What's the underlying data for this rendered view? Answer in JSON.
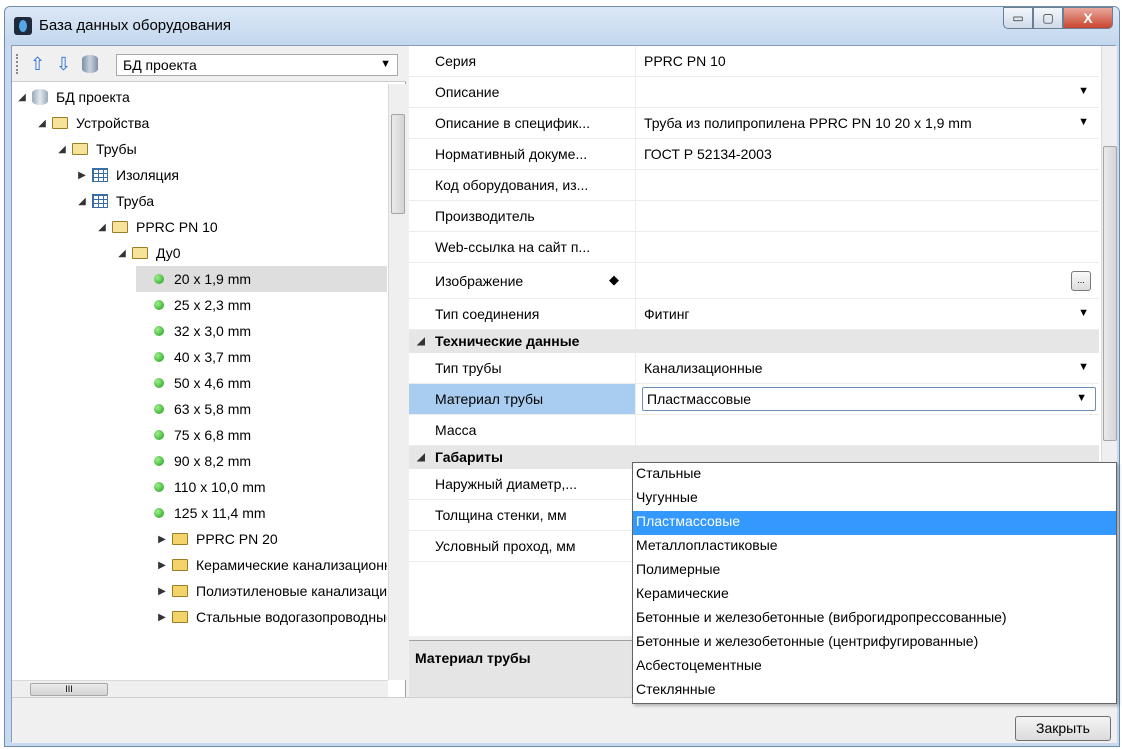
{
  "window": {
    "title": "База данных оборудования",
    "min_glyph": "▭",
    "max_glyph": "▢",
    "close_glyph": "X"
  },
  "toolbar": {
    "up_glyph": "⇧",
    "down_glyph": "⇩",
    "combo_value": "БД проекта",
    "combo_chevron": "▼"
  },
  "tree": {
    "root": "БД проекта",
    "devices": "Устройства",
    "pipes": "Трубы",
    "insulation": "Изоляция",
    "pipe": "Труба",
    "series_pn10": "PPRC PN 10",
    "du0": "Ду0",
    "sizes": [
      "20 x 1,9 mm",
      "25 x 2,3 mm",
      "32 x 3,0 mm",
      "40 x 3,7 mm",
      "50 x 4,6 mm",
      "63 x 5,8 mm",
      "75 x 6,8 mm",
      "90 x 8,2 mm",
      "110 x 10,0 mm",
      "125 x 11,4 mm"
    ],
    "series_pn20": "PPRC PN 20",
    "ceramic": "Керамические канализационные",
    "polyethylene": "Полиэтиленовые канализационные",
    "steel": "Стальные водогазопроводные"
  },
  "hscroll_glyph": "III",
  "props": [
    {
      "name": "Серия",
      "value": "PPRC PN 10",
      "dd": ""
    },
    {
      "name": "Описание",
      "value": "",
      "dd": "▼"
    },
    {
      "name": "Описание в специфик...",
      "value": "Труба из полипропилена PPRC PN 10 20 x 1,9 mm",
      "dd": "▼"
    },
    {
      "name": "Нормативный докуме...",
      "value": "ГОСТ Р 52134-2003",
      "dd": ""
    },
    {
      "name": "Код оборудования, из...",
      "value": "",
      "dd": ""
    },
    {
      "name": "Производитель",
      "value": "",
      "dd": ""
    },
    {
      "name": "Web-ссылка на сайт п...",
      "value": "",
      "dd": ""
    },
    {
      "name": "Изображение",
      "value": "",
      "dd": ""
    },
    {
      "name": "Тип соединения",
      "value": "Фитинг",
      "dd": "▼"
    }
  ],
  "image_marker": "◆",
  "ellipsis": "...",
  "cat_tech": "Технические данные",
  "tech": [
    {
      "name": "Тип трубы",
      "value": "Канализационные",
      "dd": "▼"
    },
    {
      "name": "Материал трубы",
      "value": "Пластмассовые",
      "dd": "▼"
    },
    {
      "name": "Масса",
      "value": "",
      "dd": ""
    }
  ],
  "cat_dims": "Габариты",
  "dims": [
    {
      "name": "Наружный диаметр,...",
      "value": ""
    },
    {
      "name": "Толщина стенки, мм",
      "value": ""
    },
    {
      "name": "Условный проход, мм",
      "value": ""
    }
  ],
  "description_title": "Материал трубы",
  "close_button": "Закрыть",
  "dropdown_options": [
    "Стальные",
    "Чугунные",
    "Пластмассовые",
    "Металлопластиковые",
    "Полимерные",
    "Керамические",
    "Бетонные и железобетонные (виброгидропрессованные)",
    "Бетонные и железобетонные (центрифугированные)",
    "Асбестоцементные",
    "Стеклянные"
  ],
  "dropdown_selected_index": 2
}
